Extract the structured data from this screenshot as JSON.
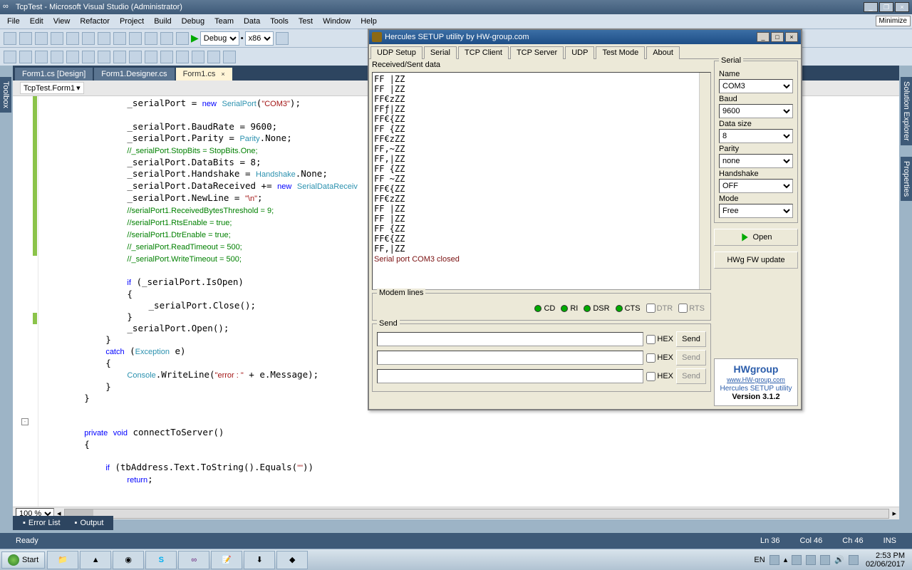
{
  "vs": {
    "title": "TcpTest - Microsoft Visual Studio (Administrator)",
    "menu": [
      "File",
      "Edit",
      "View",
      "Refactor",
      "Project",
      "Build",
      "Debug",
      "Team",
      "Data",
      "Tools",
      "Test",
      "Window",
      "Help"
    ],
    "config": "Debug",
    "platform": "x86",
    "minimize": "Minimize",
    "side_left": "Toolbox",
    "side_right1": "Solution Explorer",
    "side_right2": "Properties",
    "tabs": [
      {
        "label": "Form1.cs [Design]",
        "active": false
      },
      {
        "label": "Form1.Designer.cs",
        "active": false
      },
      {
        "label": "Form1.cs",
        "active": true
      }
    ],
    "crumb": "TcpTest.Form1",
    "zoom": "100 %",
    "bottom_tabs": [
      "Error List",
      "Output"
    ],
    "status": {
      "ready": "Ready",
      "ln": "Ln 36",
      "col": "Col 46",
      "ch": "Ch 46",
      "ins": "INS"
    }
  },
  "code": {
    "lines": [
      {
        "i": "                ",
        "t": [
          {
            "c": "",
            "s": "_serialPort = "
          },
          {
            "c": "k-blue",
            "s": "new"
          },
          {
            "c": "",
            "s": " "
          },
          {
            "c": "k-type",
            "s": "SerialPort"
          },
          {
            "c": "",
            "s": "("
          },
          {
            "c": "k-str",
            "s": "\"COM3\""
          },
          {
            "c": "",
            "s": ");"
          }
        ]
      },
      {
        "i": "",
        "t": [
          {
            "c": "",
            "s": ""
          }
        ]
      },
      {
        "i": "                ",
        "t": [
          {
            "c": "",
            "s": "_serialPort.BaudRate = 9600;"
          }
        ]
      },
      {
        "i": "                ",
        "t": [
          {
            "c": "",
            "s": "_serialPort.Parity = "
          },
          {
            "c": "k-type",
            "s": "Parity"
          },
          {
            "c": "",
            "s": ".None;"
          }
        ]
      },
      {
        "i": "                ",
        "t": [
          {
            "c": "k-cmt",
            "s": "//_serialPort.StopBits = StopBits.One;"
          }
        ]
      },
      {
        "i": "                ",
        "t": [
          {
            "c": "",
            "s": "_serialPort.DataBits = 8;"
          }
        ]
      },
      {
        "i": "                ",
        "t": [
          {
            "c": "",
            "s": "_serialPort.Handshake = "
          },
          {
            "c": "k-type",
            "s": "Handshake"
          },
          {
            "c": "",
            "s": ".None;"
          }
        ]
      },
      {
        "i": "                ",
        "t": [
          {
            "c": "",
            "s": "_serialPort.DataReceived += "
          },
          {
            "c": "k-blue",
            "s": "new"
          },
          {
            "c": "",
            "s": " "
          },
          {
            "c": "k-type",
            "s": "SerialDataReceiv"
          }
        ]
      },
      {
        "i": "                ",
        "t": [
          {
            "c": "",
            "s": "_serialPort.NewLine = "
          },
          {
            "c": "k-str",
            "s": "\"\\n\""
          },
          {
            "c": "",
            "s": ";"
          }
        ]
      },
      {
        "i": "                ",
        "t": [
          {
            "c": "k-cmt",
            "s": "//serialPort1.ReceivedBytesThreshold = 9;"
          }
        ]
      },
      {
        "i": "                ",
        "t": [
          {
            "c": "k-cmt",
            "s": "//serialPort1.RtsEnable = true;"
          }
        ]
      },
      {
        "i": "                ",
        "t": [
          {
            "c": "k-cmt",
            "s": "//serialPort1.DtrEnable = true;"
          }
        ]
      },
      {
        "i": "                ",
        "t": [
          {
            "c": "k-cmt",
            "s": "//_serialPort.ReadTimeout = 500;"
          }
        ]
      },
      {
        "i": "                ",
        "t": [
          {
            "c": "k-cmt",
            "s": "//_serialPort.WriteTimeout = 500;"
          }
        ]
      },
      {
        "i": "",
        "t": [
          {
            "c": "",
            "s": ""
          }
        ]
      },
      {
        "i": "                ",
        "t": [
          {
            "c": "k-blue",
            "s": "if"
          },
          {
            "c": "",
            "s": " (_serialPort.IsOpen)"
          }
        ]
      },
      {
        "i": "                ",
        "t": [
          {
            "c": "",
            "s": "{"
          }
        ]
      },
      {
        "i": "                    ",
        "t": [
          {
            "c": "",
            "s": "_serialPort.Close();"
          }
        ]
      },
      {
        "i": "                ",
        "t": [
          {
            "c": "",
            "s": "}"
          }
        ]
      },
      {
        "i": "                ",
        "t": [
          {
            "c": "",
            "s": "_serialPort.Open();"
          }
        ]
      },
      {
        "i": "            ",
        "t": [
          {
            "c": "",
            "s": "}"
          }
        ]
      },
      {
        "i": "            ",
        "t": [
          {
            "c": "k-blue",
            "s": "catch"
          },
          {
            "c": "",
            "s": " ("
          },
          {
            "c": "k-type",
            "s": "Exception"
          },
          {
            "c": "",
            "s": " e)"
          }
        ]
      },
      {
        "i": "            ",
        "t": [
          {
            "c": "",
            "s": "{"
          }
        ]
      },
      {
        "i": "                ",
        "t": [
          {
            "c": "k-type",
            "s": "Console"
          },
          {
            "c": "",
            "s": ".WriteLine("
          },
          {
            "c": "k-str",
            "s": "\"error : \""
          },
          {
            "c": "",
            "s": " + e.Message);"
          }
        ]
      },
      {
        "i": "            ",
        "t": [
          {
            "c": "",
            "s": "}"
          }
        ]
      },
      {
        "i": "        ",
        "t": [
          {
            "c": "",
            "s": "}"
          }
        ]
      },
      {
        "i": "",
        "t": [
          {
            "c": "",
            "s": ""
          }
        ]
      },
      {
        "i": "",
        "t": [
          {
            "c": "",
            "s": ""
          }
        ]
      },
      {
        "i": "        ",
        "t": [
          {
            "c": "k-blue",
            "s": "private"
          },
          {
            "c": "",
            "s": " "
          },
          {
            "c": "k-blue",
            "s": "void"
          },
          {
            "c": "",
            "s": " connectToServer()"
          }
        ]
      },
      {
        "i": "        ",
        "t": [
          {
            "c": "",
            "s": "{"
          }
        ]
      },
      {
        "i": "",
        "t": [
          {
            "c": "",
            "s": ""
          }
        ]
      },
      {
        "i": "            ",
        "t": [
          {
            "c": "k-blue",
            "s": "if"
          },
          {
            "c": "",
            "s": " (tbAddress.Text.ToString().Equals("
          },
          {
            "c": "k-str",
            "s": "\"\""
          },
          {
            "c": "",
            "s": "))"
          }
        ]
      },
      {
        "i": "                ",
        "t": [
          {
            "c": "k-blue",
            "s": "return"
          },
          {
            "c": "",
            "s": ";"
          }
        ]
      }
    ]
  },
  "hercules": {
    "title": "Hercules SETUP utility by HW-group.com",
    "tabs": [
      "UDP Setup",
      "Serial",
      "TCP Client",
      "TCP Server",
      "UDP",
      "Test Mode",
      "About"
    ],
    "active_tab": "Serial",
    "rx_label": "Received/Sent data",
    "rx_lines": [
      "FF |ZZ",
      "FF |ZZ",
      "FF€zZZ",
      "FFƒ|ZZ",
      "FF€{ZZ",
      "FF {ZZ",
      "FF€zZZ",
      "FF,~ZZ",
      "FF,|ZZ",
      "FF {ZZ",
      "FF ~ZZ",
      "FF€{ZZ",
      "FF€zZZ",
      "FF |ZZ",
      "FF |ZZ",
      "FF {ZZ",
      "FF€{ZZ",
      "FF,|ZZ"
    ],
    "rx_closed": "Serial port COM3 closed",
    "modem": {
      "label": "Modem lines",
      "leds": [
        "CD",
        "RI",
        "DSR",
        "CTS"
      ],
      "checks": [
        "DTR",
        "RTS"
      ]
    },
    "send": {
      "label": "Send",
      "hex": "HEX",
      "btn": "Send"
    },
    "serial": {
      "label": "Serial",
      "name_lbl": "Name",
      "name": "COM3",
      "baud_lbl": "Baud",
      "baud": "9600",
      "ds_lbl": "Data size",
      "ds": "8",
      "par_lbl": "Parity",
      "par": "none",
      "hs_lbl": "Handshake",
      "hs": "OFF",
      "mode_lbl": "Mode",
      "mode": "Free"
    },
    "open": "Open",
    "fw": "HWg FW update",
    "logo": {
      "brand_hw": "HW",
      "brand_g": "group",
      "url": "www.HW-group.com",
      "name": "Hercules SETUP utility",
      "ver": "Version  3.1.2"
    }
  },
  "taskbar": {
    "start": "Start",
    "lang": "EN",
    "time": "2:53 PM",
    "date": "02/06/2017"
  }
}
